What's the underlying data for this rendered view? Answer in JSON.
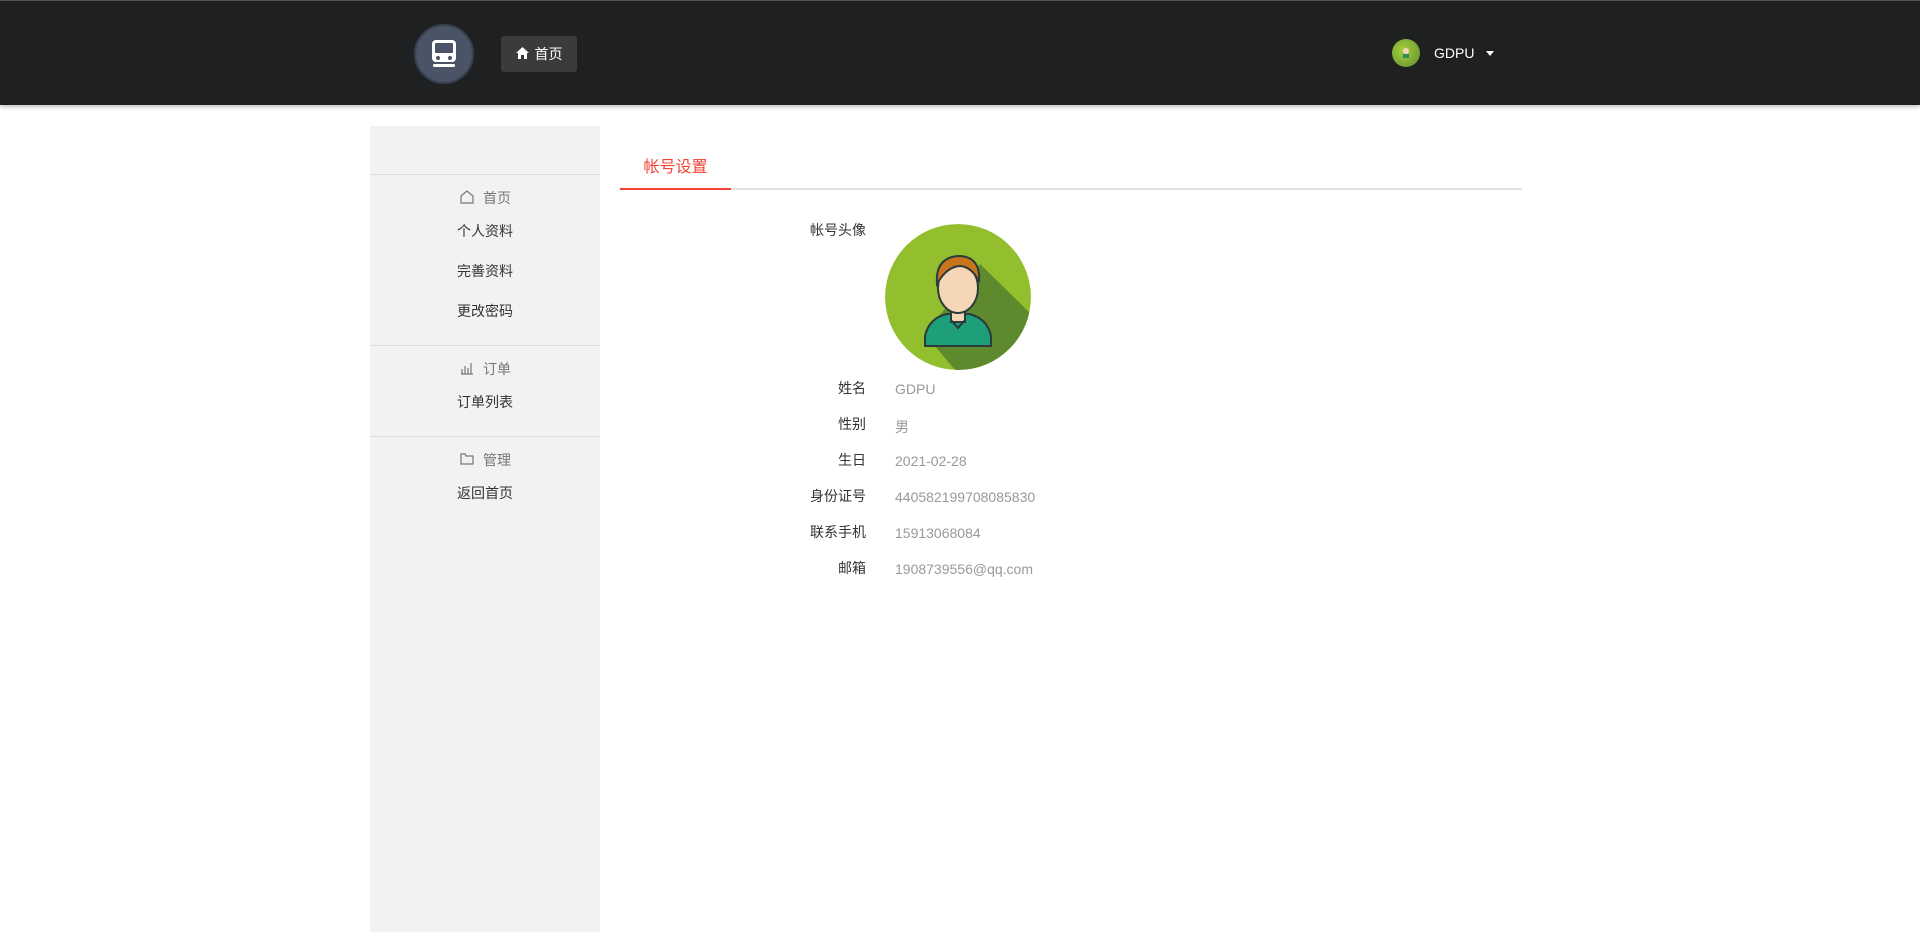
{
  "header": {
    "logo_icon": "train-icon",
    "home_button": {
      "icon": "home-icon",
      "label": "首页"
    },
    "user": {
      "name": "GDPU",
      "avatar_icon": "avatar-icon",
      "dropdown_icon": "caret-down-icon"
    },
    "background": "#1f2022"
  },
  "sidebar": {
    "groups": [
      {
        "icon": "home-outline-icon",
        "title": "首页",
        "items": [
          "个人资料",
          "完善资料",
          "更改密码"
        ]
      },
      {
        "icon": "chart-icon",
        "title": "订单",
        "items": [
          "订单列表"
        ]
      },
      {
        "icon": "folder-icon",
        "title": "管理",
        "items": [
          "返回首页"
        ]
      }
    ]
  },
  "tabs": {
    "active": "帐号设置",
    "accent": "#f44336"
  },
  "profile": {
    "avatar_label": "帐号头像",
    "fields": [
      {
        "label": "姓名",
        "value": "GDPU"
      },
      {
        "label": "性别",
        "value": "男"
      },
      {
        "label": "生日",
        "value": "2021-02-28"
      },
      {
        "label": "身份证号",
        "value": "440582199708085830"
      },
      {
        "label": "联系手机",
        "value": "15913068084"
      },
      {
        "label": "邮箱",
        "value": "1908739556@qq.com"
      }
    ]
  }
}
